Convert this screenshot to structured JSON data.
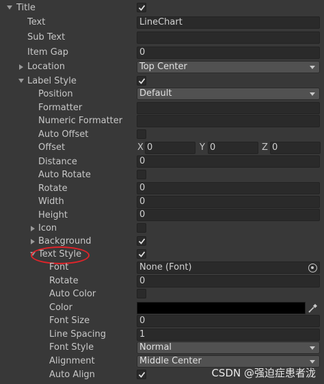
{
  "title": {
    "label": "Title",
    "checked": true
  },
  "text": {
    "label": "Text",
    "value": "LineChart"
  },
  "sub_text": {
    "label": "Sub Text",
    "value": ""
  },
  "item_gap": {
    "label": "Item Gap",
    "value": "0"
  },
  "location": {
    "label": "Location",
    "value": "Top Center"
  },
  "label_style": {
    "label": "Label Style",
    "checked": true
  },
  "position": {
    "label": "Position",
    "value": "Default"
  },
  "formatter": {
    "label": "Formatter",
    "value": ""
  },
  "numeric_formatter": {
    "label": "Numeric Formatter",
    "value": ""
  },
  "auto_offset": {
    "label": "Auto Offset",
    "checked": false
  },
  "offset": {
    "label": "Offset",
    "x_label": "X",
    "x": "0",
    "y_label": "Y",
    "y": "0",
    "z_label": "Z",
    "z": "0"
  },
  "distance": {
    "label": "Distance",
    "value": "0"
  },
  "auto_rotate": {
    "label": "Auto Rotate",
    "checked": false
  },
  "rotate": {
    "label": "Rotate",
    "value": "0"
  },
  "width": {
    "label": "Width",
    "value": "0"
  },
  "height": {
    "label": "Height",
    "value": "0"
  },
  "icon": {
    "label": "Icon",
    "checked": false
  },
  "background": {
    "label": "Background",
    "checked": true
  },
  "text_style": {
    "label": "Text Style",
    "checked": true
  },
  "font": {
    "label": "Font",
    "value": "None (Font)"
  },
  "ts_rotate": {
    "label": "Rotate",
    "value": "0"
  },
  "auto_color": {
    "label": "Auto Color",
    "checked": false
  },
  "color": {
    "label": "Color",
    "value": "#000000"
  },
  "font_size": {
    "label": "Font Size",
    "value": "0"
  },
  "line_spacing": {
    "label": "Line Spacing",
    "value": "1"
  },
  "font_style": {
    "label": "Font Style",
    "value": "Normal"
  },
  "alignment": {
    "label": "Alignment",
    "value": "Middle Center"
  },
  "auto_align": {
    "label": "Auto Align",
    "checked": true
  },
  "watermark": "CSDN @强迫症患者泷",
  "colors": {
    "background": "#383838",
    "field": "#2a2a2a",
    "dropdown": "#515151",
    "highlight": "#e0242a"
  },
  "icons": [
    "expand-triangle-icon",
    "collapse-triangle-icon",
    "checkmark-icon",
    "eyedropper-icon",
    "object-picker-icon",
    "dropdown-arrow-icon"
  ]
}
